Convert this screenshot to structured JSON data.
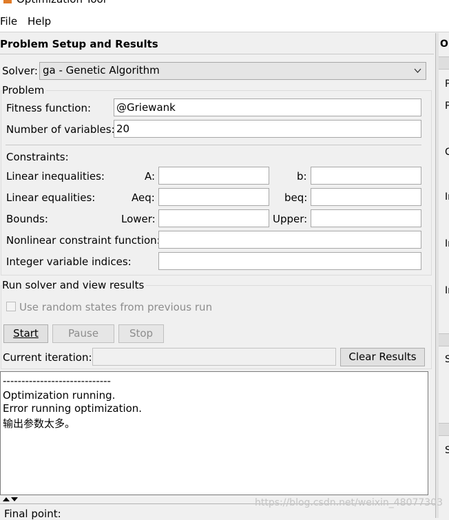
{
  "window": {
    "title": "Optimization Tool"
  },
  "menu": {
    "file_label": "File",
    "help_label": "Help"
  },
  "panel": {
    "title": "Problem Setup and Results"
  },
  "solver": {
    "label": "Solver:",
    "value": "ga - Genetic Algorithm"
  },
  "problem": {
    "group_label": "Problem",
    "fitness_label": "Fitness function:",
    "fitness_value": "@Griewank",
    "nvars_label": "Number of variables:",
    "nvars_value": "20"
  },
  "constraints": {
    "group_label": "Constraints:",
    "linear_ineq_label": "Linear inequalities:",
    "a_label": "A:",
    "b_label": "b:",
    "linear_eq_label": "Linear equalities:",
    "aeq_label": "Aeq:",
    "beq_label": "beq:",
    "bounds_label": "Bounds:",
    "lower_label": "Lower:",
    "upper_label": "Upper:",
    "nonlinear_label": "Nonlinear constraint function:",
    "integer_label": "Integer variable indices:"
  },
  "run": {
    "group_label": "Run solver and view results",
    "random_states_label": "Use random states from previous run",
    "start_label": "Start",
    "pause_label": "Pause",
    "stop_label": "Stop",
    "current_iteration_label": "Current iteration:",
    "clear_results_label": "Clear Results"
  },
  "output": {
    "lines": [
      "-----------------------------",
      "Optimization running.",
      "Error running optimization.",
      "输出参数太多。"
    ]
  },
  "final_point": {
    "label": "Final point:"
  },
  "right_panel": {
    "letters": [
      "O",
      "P",
      "P",
      "C",
      "In",
      "In",
      "In",
      "S",
      "S"
    ]
  },
  "watermark": {
    "text": "https://blog.csdn.net/weixin_48077303"
  }
}
